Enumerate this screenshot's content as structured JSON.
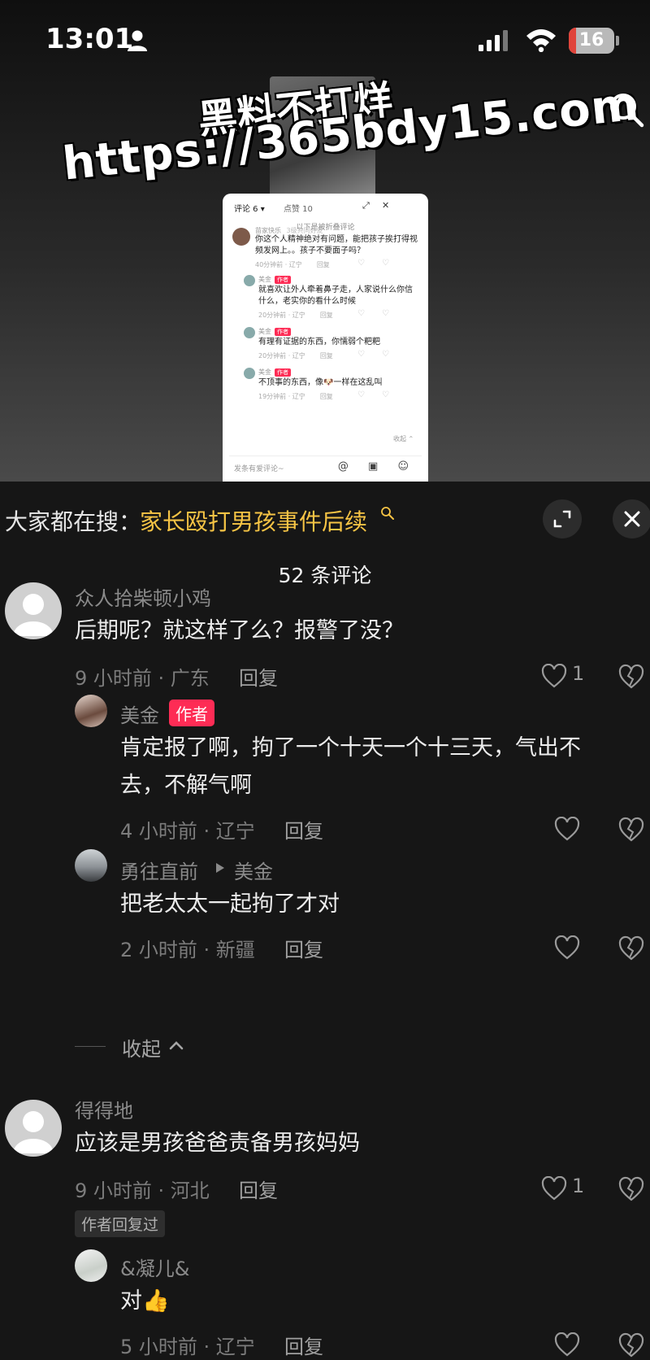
{
  "status_bar": {
    "time": "13:01",
    "battery_level": "16",
    "battery_fraction": 0.16,
    "icons": [
      "person-icon",
      "signal-icon",
      "wifi-icon",
      "battery-icon"
    ]
  },
  "watermark": {
    "line1": "黑料不打烊",
    "line2": "https://365bdy15.com"
  },
  "embedded_screenshot": {
    "tab_comments": "评论 6 ▾",
    "tab_likes": "点赞 10",
    "folded_hint": "以下是被折叠评论",
    "comments": [
      {
        "name": "苗家快乐",
        "badge": "3级共同好友",
        "text": "你这个人精神绝对有问题，能把孩子挨打得视频发网上。。孩子不要面子吗？",
        "meta": "40分钟前 · 辽宁",
        "reply": "回复"
      },
      {
        "name": "美金",
        "tag": "作者",
        "text": "就喜欢让外人牵着鼻子走，人家说什么你信什么，老实你的看什么时候",
        "meta": "20分钟前 · 辽宁",
        "reply": "回复"
      },
      {
        "name": "美金",
        "tag": "作者",
        "text": "有理有证据的东西，你懦弱个粑粑",
        "meta": "20分钟前 · 辽宁",
        "reply": "回复"
      },
      {
        "name": "美金",
        "tag": "作者",
        "text": "不顶事的东西，像🐶一样在这乱叫",
        "meta": "19分钟前 · 辽宁",
        "reply": "回复"
      }
    ],
    "fold_label": "收起 ⌃",
    "input_placeholder": "发条有爱评论~",
    "input_icons": "@ ▣ ☺"
  },
  "search_bar": {
    "label": "大家都在搜：",
    "keyword": "家长殴打男孩事件后续"
  },
  "comment_count": "52 条评论",
  "comments": [
    {
      "user": "众人拾柴顿小鸡",
      "text": "后期呢？就这样了么？报警了没？",
      "meta": "9 小时前 · 广东",
      "reply_label": "回复",
      "likes": "1"
    },
    {
      "user": "美金",
      "author_tag": "作者",
      "text_line1": "肯定报了啊，拘了一个十天一个十三天，气出不",
      "text_line2": "去，不解气啊",
      "meta": "4 小时前 · 辽宁",
      "reply_label": "回复"
    },
    {
      "user": "勇往直前",
      "reply_to": "美金",
      "text": "把老太太一起拘了才对",
      "meta": "2 小时前 · 新疆",
      "reply_label": "回复"
    },
    {
      "user": "得得地",
      "text": "应该是男孩爸爸责备男孩妈妈",
      "meta": "9 小时前 · 河北",
      "reply_label": "回复",
      "likes": "1",
      "badge": "作者回复过"
    },
    {
      "user": "&凝儿&",
      "text": "对👍",
      "meta": "5 小时前 · 辽宁",
      "reply_label": "回复"
    }
  ],
  "collapse_label": "收起",
  "colors": {
    "background": "#161616",
    "accent_keyword": "#f6c445",
    "author_tag": "#fe2c55",
    "battery_low": "#e0443a"
  }
}
